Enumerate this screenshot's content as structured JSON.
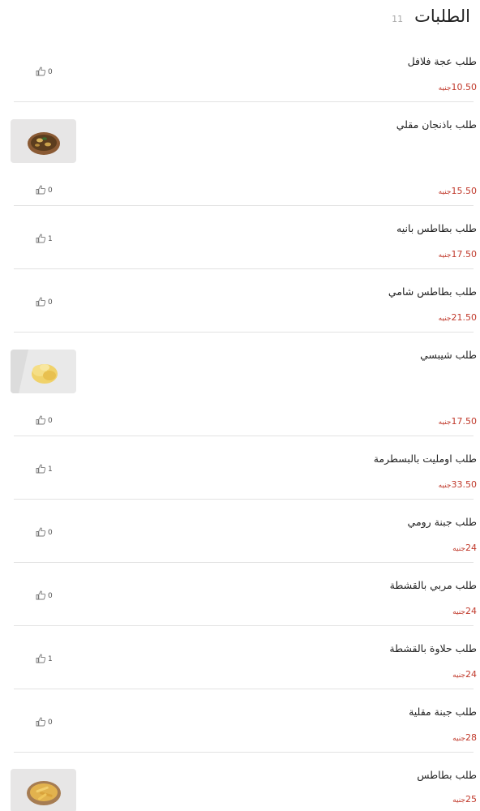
{
  "header": {
    "title": "الطلبات",
    "count": "11"
  },
  "currency": "جنيه",
  "items": [
    {
      "name": "طلب عجة فلافل",
      "price": "10.50",
      "likes": "0",
      "image": "none"
    },
    {
      "name": "طلب باذنجان مقلي",
      "price": "15.50",
      "likes": "0",
      "image": "fried-eggplant-plate"
    },
    {
      "name": "طلب بطاطس بانيه",
      "price": "17.50",
      "likes": "1",
      "image": "none"
    },
    {
      "name": "طلب بطاطس شامي",
      "price": "21.50",
      "likes": "0",
      "image": "none"
    },
    {
      "name": "طلب شيبسي",
      "price": "17.50",
      "likes": "0",
      "image": "chips-bowl"
    },
    {
      "name": "طلب اومليت بالبسطرمة",
      "price": "33.50",
      "likes": "1",
      "image": "none"
    },
    {
      "name": "طلب جبنة رومي",
      "price": "24",
      "likes": "0",
      "image": "none"
    },
    {
      "name": "طلب مربي بالقشطة",
      "price": "24",
      "likes": "0",
      "image": "none"
    },
    {
      "name": "طلب حلاوة بالقشطة",
      "price": "24",
      "likes": "1",
      "image": "none"
    },
    {
      "name": "طلب جبنة مقلية",
      "price": "28",
      "likes": "0",
      "image": "none"
    },
    {
      "name": "طلب بطاطس",
      "price": "25",
      "likes": "",
      "image": "fries-plate"
    }
  ],
  "colors": {
    "price": "#c0392b",
    "divider": "#e2e2e2",
    "title": "#222222",
    "count": "#aaaaaa"
  },
  "icons": {
    "like": "thumbs-up-icon"
  }
}
